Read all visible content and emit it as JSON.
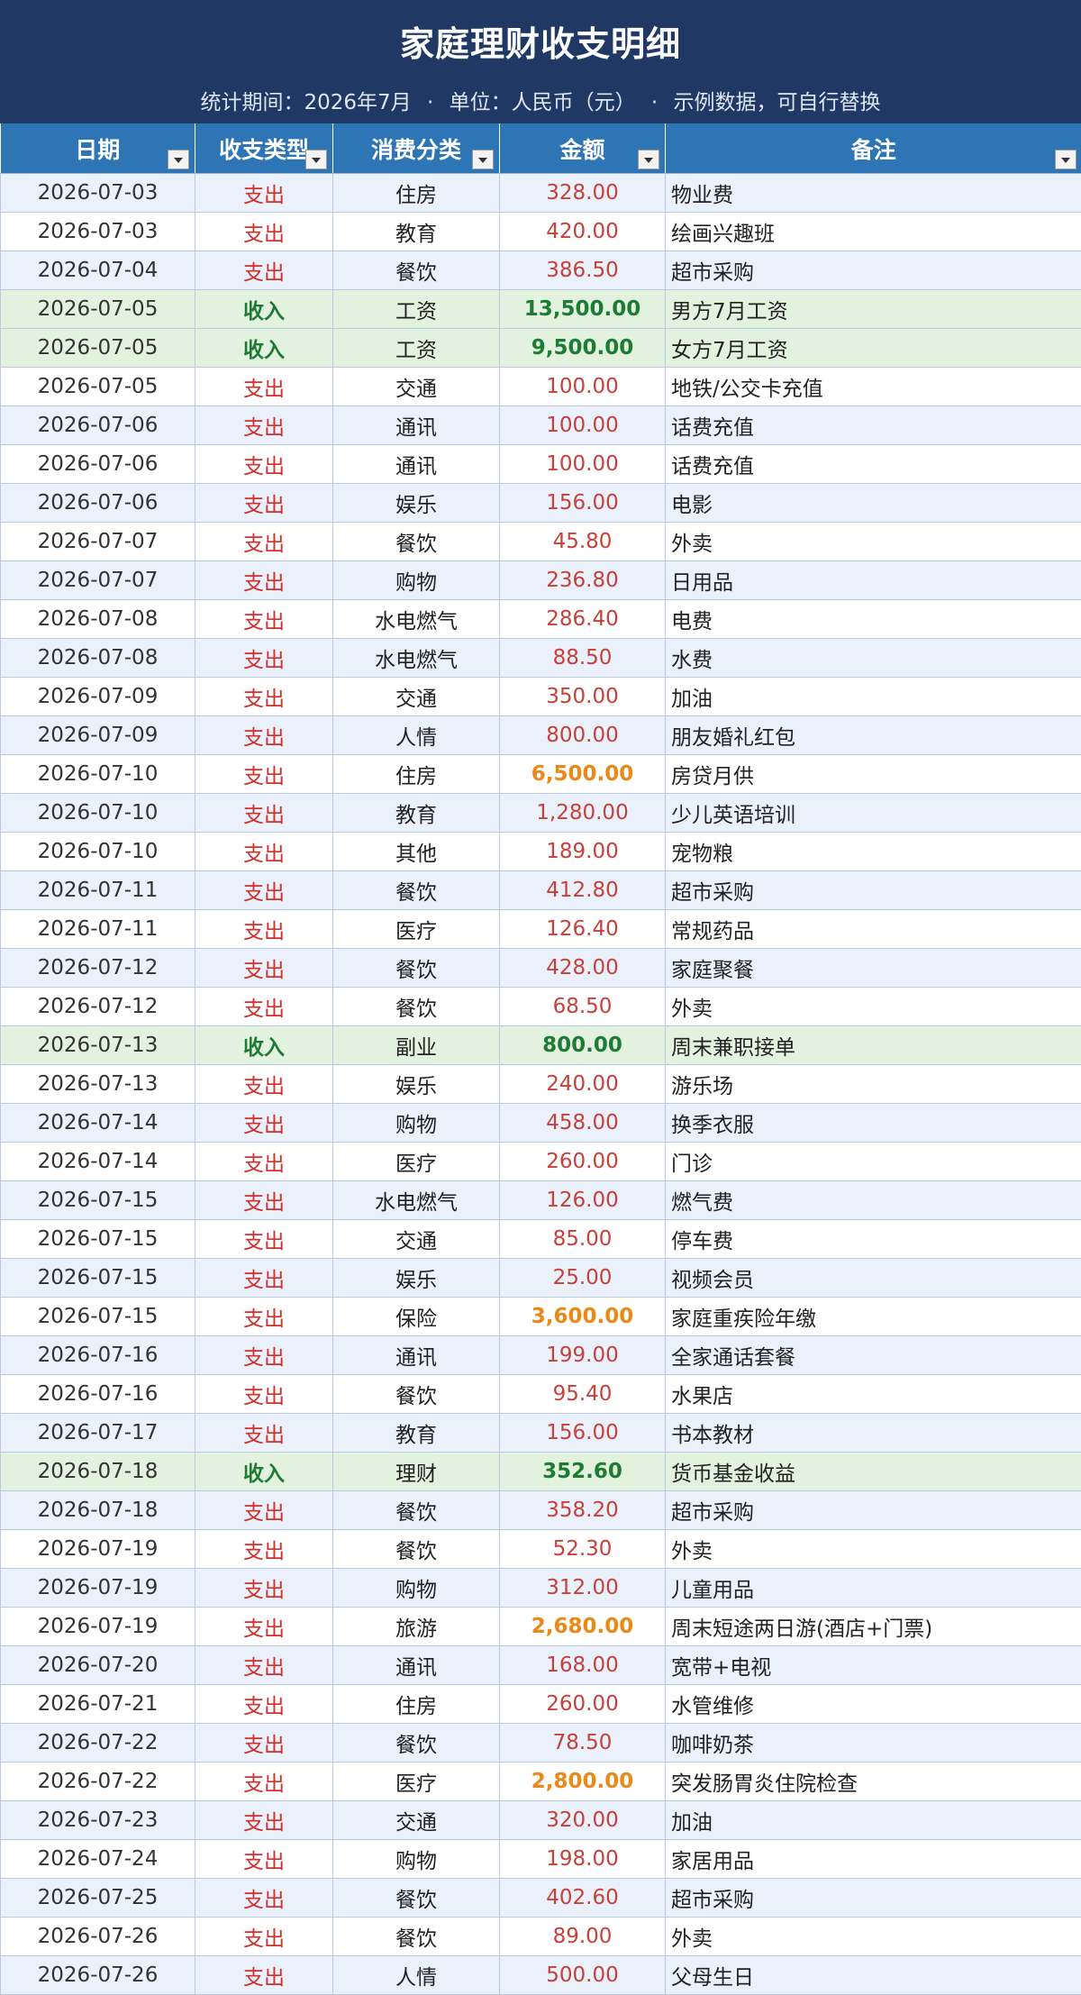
{
  "header": {
    "title": "家庭理财收支明细",
    "period_label": "统计期间：2026年7月",
    "unit_label": "单位：人民币（元）",
    "note_label": "示例数据，可自行替换",
    "separator": "·"
  },
  "columns": [
    "日期",
    "收支类型",
    "消费分类",
    "金额",
    "备注"
  ],
  "colors": {
    "title_bg": "#1f3864",
    "header_bg": "#2e75b6",
    "expense": "#d0312d",
    "income": "#1e7b34",
    "large_amount": "#e8891a",
    "row_alt": "#eaf1fb",
    "row_income": "#e3f1df"
  },
  "rows": [
    {
      "date": "2026-07-03",
      "type": "支出",
      "category": "住房",
      "amount": "328.00",
      "note": "物业费",
      "kind": "expense",
      "big": false
    },
    {
      "date": "2026-07-03",
      "type": "支出",
      "category": "教育",
      "amount": "420.00",
      "note": "绘画兴趣班",
      "kind": "expense",
      "big": false
    },
    {
      "date": "2026-07-04",
      "type": "支出",
      "category": "餐饮",
      "amount": "386.50",
      "note": "超市采购",
      "kind": "expense",
      "big": false
    },
    {
      "date": "2026-07-05",
      "type": "收入",
      "category": "工资",
      "amount": "13,500.00",
      "note": "男方7月工资",
      "kind": "income",
      "big": true
    },
    {
      "date": "2026-07-05",
      "type": "收入",
      "category": "工资",
      "amount": "9,500.00",
      "note": "女方7月工资",
      "kind": "income",
      "big": true
    },
    {
      "date": "2026-07-05",
      "type": "支出",
      "category": "交通",
      "amount": "100.00",
      "note": "地铁/公交卡充值",
      "kind": "expense",
      "big": false
    },
    {
      "date": "2026-07-06",
      "type": "支出",
      "category": "通讯",
      "amount": "100.00",
      "note": "话费充值",
      "kind": "expense",
      "big": false
    },
    {
      "date": "2026-07-06",
      "type": "支出",
      "category": "通讯",
      "amount": "100.00",
      "note": "话费充值",
      "kind": "expense",
      "big": false
    },
    {
      "date": "2026-07-06",
      "type": "支出",
      "category": "娱乐",
      "amount": "156.00",
      "note": "电影",
      "kind": "expense",
      "big": false
    },
    {
      "date": "2026-07-07",
      "type": "支出",
      "category": "餐饮",
      "amount": "45.80",
      "note": "外卖",
      "kind": "expense",
      "big": false
    },
    {
      "date": "2026-07-07",
      "type": "支出",
      "category": "购物",
      "amount": "236.80",
      "note": "日用品",
      "kind": "expense",
      "big": false
    },
    {
      "date": "2026-07-08",
      "type": "支出",
      "category": "水电燃气",
      "amount": "286.40",
      "note": "电费",
      "kind": "expense",
      "big": false
    },
    {
      "date": "2026-07-08",
      "type": "支出",
      "category": "水电燃气",
      "amount": "88.50",
      "note": "水费",
      "kind": "expense",
      "big": false
    },
    {
      "date": "2026-07-09",
      "type": "支出",
      "category": "交通",
      "amount": "350.00",
      "note": "加油",
      "kind": "expense",
      "big": false
    },
    {
      "date": "2026-07-09",
      "type": "支出",
      "category": "人情",
      "amount": "800.00",
      "note": "朋友婚礼红包",
      "kind": "expense",
      "big": false
    },
    {
      "date": "2026-07-10",
      "type": "支出",
      "category": "住房",
      "amount": "6,500.00",
      "note": "房贷月供",
      "kind": "expense",
      "big": true
    },
    {
      "date": "2026-07-10",
      "type": "支出",
      "category": "教育",
      "amount": "1,280.00",
      "note": "少儿英语培训",
      "kind": "expense",
      "big": false
    },
    {
      "date": "2026-07-10",
      "type": "支出",
      "category": "其他",
      "amount": "189.00",
      "note": "宠物粮",
      "kind": "expense",
      "big": false
    },
    {
      "date": "2026-07-11",
      "type": "支出",
      "category": "餐饮",
      "amount": "412.80",
      "note": "超市采购",
      "kind": "expense",
      "big": false
    },
    {
      "date": "2026-07-11",
      "type": "支出",
      "category": "医疗",
      "amount": "126.40",
      "note": "常规药品",
      "kind": "expense",
      "big": false
    },
    {
      "date": "2026-07-12",
      "type": "支出",
      "category": "餐饮",
      "amount": "428.00",
      "note": "家庭聚餐",
      "kind": "expense",
      "big": false
    },
    {
      "date": "2026-07-12",
      "type": "支出",
      "category": "餐饮",
      "amount": "68.50",
      "note": "外卖",
      "kind": "expense",
      "big": false
    },
    {
      "date": "2026-07-13",
      "type": "收入",
      "category": "副业",
      "amount": "800.00",
      "note": "周末兼职接单",
      "kind": "income",
      "big": false
    },
    {
      "date": "2026-07-13",
      "type": "支出",
      "category": "娱乐",
      "amount": "240.00",
      "note": "游乐场",
      "kind": "expense",
      "big": false
    },
    {
      "date": "2026-07-14",
      "type": "支出",
      "category": "购物",
      "amount": "458.00",
      "note": "换季衣服",
      "kind": "expense",
      "big": false
    },
    {
      "date": "2026-07-14",
      "type": "支出",
      "category": "医疗",
      "amount": "260.00",
      "note": "门诊",
      "kind": "expense",
      "big": false
    },
    {
      "date": "2026-07-15",
      "type": "支出",
      "category": "水电燃气",
      "amount": "126.00",
      "note": "燃气费",
      "kind": "expense",
      "big": false
    },
    {
      "date": "2026-07-15",
      "type": "支出",
      "category": "交通",
      "amount": "85.00",
      "note": "停车费",
      "kind": "expense",
      "big": false
    },
    {
      "date": "2026-07-15",
      "type": "支出",
      "category": "娱乐",
      "amount": "25.00",
      "note": "视频会员",
      "kind": "expense",
      "big": false
    },
    {
      "date": "2026-07-15",
      "type": "支出",
      "category": "保险",
      "amount": "3,600.00",
      "note": "家庭重疾险年缴",
      "kind": "expense",
      "big": true
    },
    {
      "date": "2026-07-16",
      "type": "支出",
      "category": "通讯",
      "amount": "199.00",
      "note": "全家通话套餐",
      "kind": "expense",
      "big": false
    },
    {
      "date": "2026-07-16",
      "type": "支出",
      "category": "餐饮",
      "amount": "95.40",
      "note": "水果店",
      "kind": "expense",
      "big": false
    },
    {
      "date": "2026-07-17",
      "type": "支出",
      "category": "教育",
      "amount": "156.00",
      "note": "书本教材",
      "kind": "expense",
      "big": false
    },
    {
      "date": "2026-07-18",
      "type": "收入",
      "category": "理财",
      "amount": "352.60",
      "note": "货币基金收益",
      "kind": "income",
      "big": false
    },
    {
      "date": "2026-07-18",
      "type": "支出",
      "category": "餐饮",
      "amount": "358.20",
      "note": "超市采购",
      "kind": "expense",
      "big": false
    },
    {
      "date": "2026-07-19",
      "type": "支出",
      "category": "餐饮",
      "amount": "52.30",
      "note": "外卖",
      "kind": "expense",
      "big": false
    },
    {
      "date": "2026-07-19",
      "type": "支出",
      "category": "购物",
      "amount": "312.00",
      "note": "儿童用品",
      "kind": "expense",
      "big": false
    },
    {
      "date": "2026-07-19",
      "type": "支出",
      "category": "旅游",
      "amount": "2,680.00",
      "note": "周末短途两日游(酒店+门票)",
      "kind": "expense",
      "big": true
    },
    {
      "date": "2026-07-20",
      "type": "支出",
      "category": "通讯",
      "amount": "168.00",
      "note": "宽带+电视",
      "kind": "expense",
      "big": false
    },
    {
      "date": "2026-07-21",
      "type": "支出",
      "category": "住房",
      "amount": "260.00",
      "note": "水管维修",
      "kind": "expense",
      "big": false
    },
    {
      "date": "2026-07-22",
      "type": "支出",
      "category": "餐饮",
      "amount": "78.50",
      "note": "咖啡奶茶",
      "kind": "expense",
      "big": false
    },
    {
      "date": "2026-07-22",
      "type": "支出",
      "category": "医疗",
      "amount": "2,800.00",
      "note": "突发肠胃炎住院检查",
      "kind": "expense",
      "big": true
    },
    {
      "date": "2026-07-23",
      "type": "支出",
      "category": "交通",
      "amount": "320.00",
      "note": "加油",
      "kind": "expense",
      "big": false
    },
    {
      "date": "2026-07-24",
      "type": "支出",
      "category": "购物",
      "amount": "198.00",
      "note": "家居用品",
      "kind": "expense",
      "big": false
    },
    {
      "date": "2026-07-25",
      "type": "支出",
      "category": "餐饮",
      "amount": "402.60",
      "note": "超市采购",
      "kind": "expense",
      "big": false
    },
    {
      "date": "2026-07-26",
      "type": "支出",
      "category": "餐饮",
      "amount": "89.00",
      "note": "外卖",
      "kind": "expense",
      "big": false
    },
    {
      "date": "2026-07-26",
      "type": "支出",
      "category": "人情",
      "amount": "500.00",
      "note": "父母生日",
      "kind": "expense",
      "big": false
    }
  ]
}
